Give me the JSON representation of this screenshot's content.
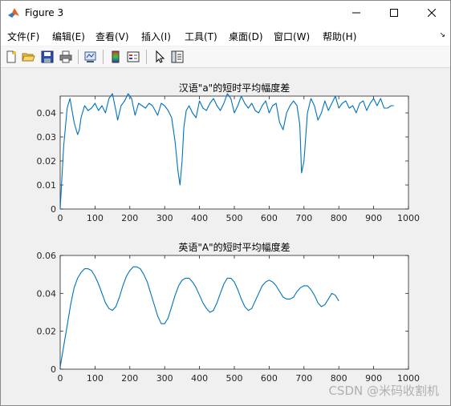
{
  "window": {
    "title": "Figure 3"
  },
  "menu": {
    "items": [
      "文件(F)",
      "编辑(E)",
      "查看(V)",
      "插入(I)",
      "工具(T)",
      "桌面(D)",
      "窗口(W)",
      "帮助(H)"
    ],
    "more_arrow": "↘"
  },
  "toolbar": {
    "icons": [
      "new-figure-icon",
      "open-file-icon",
      "save-icon",
      "print-icon",
      "link-plot-icon",
      "insert-colorbar-icon",
      "insert-legend-icon",
      "pointer-icon",
      "property-inspector-icon"
    ]
  },
  "watermark": "CSDN @米码收割机",
  "chart_data": [
    {
      "type": "line",
      "title": "汉语\"a\"的短时平均幅度差",
      "xlim": [
        0,
        1000
      ],
      "ylim": [
        0,
        0.047
      ],
      "xticks": [
        0,
        100,
        200,
        300,
        400,
        500,
        600,
        700,
        800,
        900,
        1000
      ],
      "yticks": [
        0,
        0.01,
        0.02,
        0.03,
        0.04
      ],
      "ytick_labels": [
        "0",
        "0.01",
        "0.02",
        "0.03",
        "0.04"
      ],
      "color": "#0072bd",
      "x": [
        0,
        10,
        20,
        28,
        40,
        50,
        55,
        60,
        70,
        80,
        90,
        100,
        110,
        120,
        130,
        140,
        150,
        160,
        165,
        175,
        185,
        195,
        205,
        215,
        225,
        235,
        245,
        255,
        265,
        280,
        290,
        300,
        310,
        320,
        330,
        338,
        344,
        350,
        355,
        362,
        370,
        380,
        390,
        400,
        410,
        420,
        430,
        440,
        450,
        460,
        470,
        480,
        490,
        500,
        510,
        520,
        530,
        540,
        550,
        560,
        570,
        580,
        590,
        600,
        610,
        620,
        630,
        640,
        650,
        660,
        670,
        680,
        688,
        693,
        700,
        710,
        720,
        730,
        740,
        750,
        760,
        770,
        780,
        790,
        800,
        810,
        820,
        830,
        840,
        850,
        860,
        870,
        880,
        890,
        900,
        910,
        920,
        930,
        940,
        950,
        958
      ],
      "y": [
        0.0,
        0.026,
        0.042,
        0.046,
        0.036,
        0.031,
        0.033,
        0.038,
        0.043,
        0.041,
        0.042,
        0.044,
        0.041,
        0.043,
        0.04,
        0.046,
        0.048,
        0.041,
        0.037,
        0.043,
        0.045,
        0.048,
        0.046,
        0.039,
        0.044,
        0.043,
        0.042,
        0.044,
        0.043,
        0.039,
        0.044,
        0.043,
        0.041,
        0.038,
        0.028,
        0.016,
        0.01,
        0.02,
        0.034,
        0.041,
        0.043,
        0.04,
        0.038,
        0.045,
        0.042,
        0.041,
        0.044,
        0.046,
        0.043,
        0.041,
        0.044,
        0.048,
        0.046,
        0.04,
        0.043,
        0.047,
        0.044,
        0.042,
        0.044,
        0.041,
        0.04,
        0.043,
        0.045,
        0.04,
        0.043,
        0.044,
        0.036,
        0.033,
        0.04,
        0.043,
        0.045,
        0.043,
        0.035,
        0.015,
        0.02,
        0.04,
        0.046,
        0.043,
        0.037,
        0.04,
        0.045,
        0.041,
        0.044,
        0.047,
        0.042,
        0.044,
        0.045,
        0.042,
        0.043,
        0.04,
        0.044,
        0.045,
        0.041,
        0.044,
        0.046,
        0.043,
        0.046,
        0.042,
        0.042,
        0.043,
        0.043
      ]
    },
    {
      "type": "line",
      "title": "英语\"A\"的短时平均幅度差",
      "xlim": [
        0,
        1000
      ],
      "ylim": [
        0,
        0.06
      ],
      "xticks": [
        0,
        100,
        200,
        300,
        400,
        500,
        600,
        700,
        800,
        900,
        1000
      ],
      "yticks": [
        0,
        0.02,
        0.04,
        0.06
      ],
      "ytick_labels": [
        "0",
        "0.02",
        "0.04",
        "0.06"
      ],
      "color": "#0072bd",
      "x": [
        0,
        10,
        20,
        30,
        40,
        50,
        60,
        70,
        80,
        90,
        100,
        110,
        120,
        130,
        140,
        150,
        160,
        170,
        180,
        190,
        200,
        210,
        220,
        230,
        240,
        250,
        260,
        270,
        280,
        290,
        300,
        310,
        320,
        330,
        340,
        350,
        360,
        370,
        380,
        390,
        400,
        410,
        420,
        430,
        440,
        450,
        460,
        470,
        480,
        490,
        500,
        510,
        520,
        530,
        540,
        550,
        560,
        570,
        580,
        590,
        600,
        610,
        620,
        630,
        640,
        650,
        660,
        670,
        680,
        690,
        700,
        710,
        720,
        730,
        740,
        750,
        760,
        770,
        780,
        790,
        800,
        810,
        820,
        830,
        840,
        850,
        860,
        870,
        880,
        890,
        900,
        910,
        920,
        930,
        940,
        950,
        958
      ],
      "y": [
        0.001,
        0.012,
        0.023,
        0.034,
        0.043,
        0.048,
        0.051,
        0.053,
        0.053,
        0.052,
        0.049,
        0.045,
        0.04,
        0.035,
        0.032,
        0.031,
        0.033,
        0.038,
        0.044,
        0.049,
        0.052,
        0.054,
        0.054,
        0.053,
        0.05,
        0.046,
        0.04,
        0.034,
        0.028,
        0.024,
        0.024,
        0.027,
        0.033,
        0.039,
        0.044,
        0.047,
        0.048,
        0.048,
        0.046,
        0.043,
        0.039,
        0.035,
        0.032,
        0.03,
        0.031,
        0.035,
        0.04,
        0.045,
        0.048,
        0.048,
        0.046,
        0.042,
        0.037,
        0.033,
        0.031,
        0.032,
        0.036,
        0.04,
        0.044,
        0.046,
        0.047,
        0.046,
        0.044,
        0.041,
        0.038,
        0.037,
        0.037,
        0.038,
        0.041,
        0.043,
        0.044,
        0.044,
        0.042,
        0.039,
        0.035,
        0.033,
        0.034,
        0.037,
        0.04,
        0.039,
        0.036
      ]
    }
  ]
}
